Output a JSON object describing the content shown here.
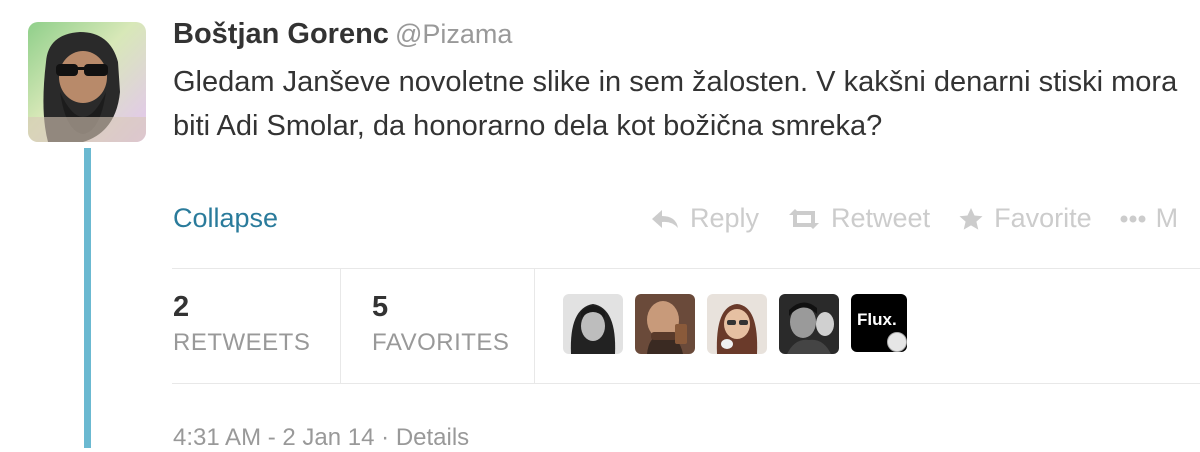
{
  "tweet": {
    "author_name": "Boštjan Gorenc",
    "author_handle": "@Pizama",
    "text": "Gledam Janševe novoletne slike in sem žalosten. V kakšni denarni stiski mora biti Adi Smolar, da honorarno dela kot božična smreka?",
    "collapse_label": "Collapse"
  },
  "actions": {
    "reply_label": "Reply",
    "retweet_label": "Retweet",
    "favorite_label": "Favorite",
    "more_label": "M"
  },
  "stats": {
    "retweets_count": "2",
    "retweets_label": "RETWEETS",
    "favorites_count": "5",
    "favorites_label": "FAVORITES"
  },
  "favoriters": {
    "flux_label": "Flux."
  },
  "meta": {
    "timestamp": "4:31 AM - 2 Jan 14",
    "separator": "·",
    "details_label": "Details"
  },
  "colors": {
    "link": "#2a7b9b",
    "thread_line": "#6bb9d1",
    "muted": "#999999",
    "action_muted": "#cccccc"
  }
}
